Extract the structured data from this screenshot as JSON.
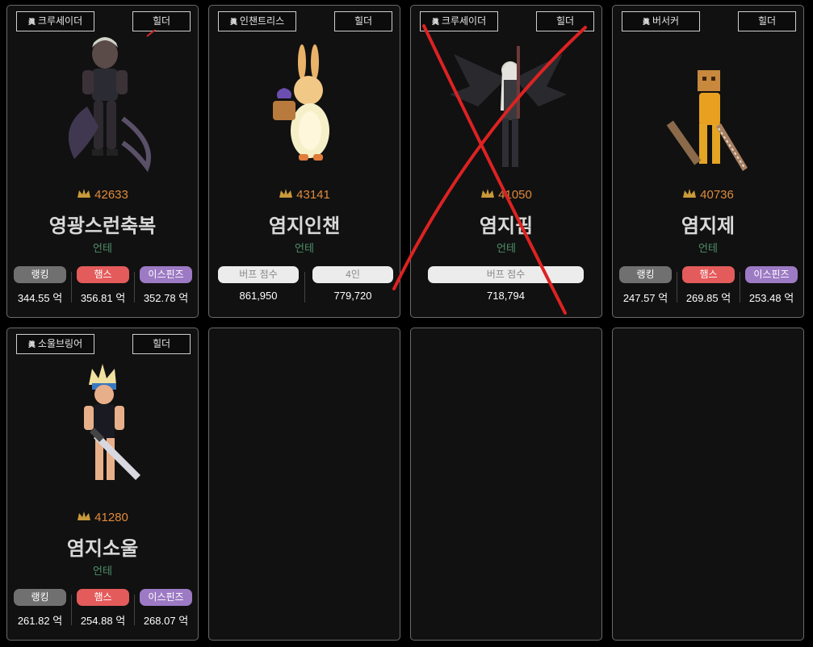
{
  "cards": [
    {
      "job": "크루세이더",
      "role": "힐더",
      "score": "42633",
      "name": "영광스런축복",
      "server": "언테",
      "stats": [
        {
          "label": "랭킹",
          "value": "344.55 억"
        },
        {
          "label": "햄스",
          "value": "356.81 억"
        },
        {
          "label": "이스핀즈",
          "value": "352.78 억"
        }
      ]
    },
    {
      "job": "인챈트리스",
      "role": "힐더",
      "score": "43141",
      "name": "염지인챈",
      "server": "언테",
      "stats": [
        {
          "label": "버프 점수",
          "value": "861,950"
        },
        {
          "label": "4인",
          "value": "779,720"
        }
      ]
    },
    {
      "job": "크루세이더",
      "role": "힐더",
      "score": "41050",
      "name": "염지핌",
      "server": "언테",
      "stats": [
        {
          "label": "버프 점수",
          "value": "718,794"
        }
      ]
    },
    {
      "job": "버서커",
      "role": "힐더",
      "score": "40736",
      "name": "염지제",
      "server": "언테",
      "stats": [
        {
          "label": "랭킹",
          "value": "247.57 억"
        },
        {
          "label": "햄스",
          "value": "269.85 억"
        },
        {
          "label": "이스핀즈",
          "value": "253.48 억"
        }
      ]
    },
    {
      "job": "소울브링어",
      "role": "힐더",
      "score": "41280",
      "name": "염지소울",
      "server": "언테",
      "stats": [
        {
          "label": "랭킹",
          "value": "261.82 억"
        },
        {
          "label": "햄스",
          "value": "254.88 억"
        },
        {
          "label": "이스핀즈",
          "value": "268.07 억"
        }
      ]
    }
  ],
  "jin_mark": "眞",
  "colors": {
    "background": "#000000",
    "card": "#111111",
    "score": "#e08a3c",
    "server": "#4f8f6a",
    "ranking_pill": "#707070",
    "hams_pill": "#e45b5b",
    "ispins_pill": "#9d7ac4",
    "buff_pill": "#ececec",
    "annotation": "#dd2222"
  }
}
